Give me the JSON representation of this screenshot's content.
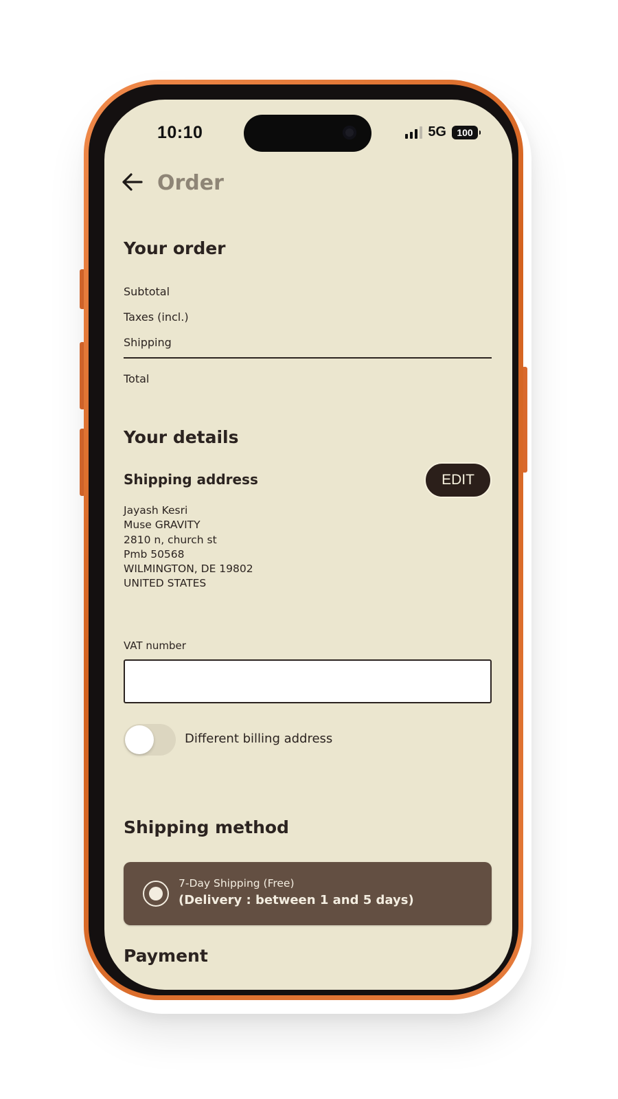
{
  "status_bar": {
    "time": "10:10",
    "network": "5G",
    "battery": "100"
  },
  "header": {
    "title": "Order",
    "back_icon": "arrow-left-icon"
  },
  "order": {
    "heading": "Your order",
    "rows": [
      "Subtotal",
      "Taxes (incl.)",
      "Shipping"
    ],
    "total_label": "Total"
  },
  "details": {
    "heading": "Your details",
    "shipping_address_label": "Shipping address",
    "edit_label": "EDIT",
    "address_lines": [
      "Jayash Kesri",
      "Muse GRAVITY",
      "2810 n, church st",
      "Pmb 50568",
      "WILMINGTON, DE 19802",
      "UNITED STATES"
    ],
    "vat_label": "VAT number",
    "vat_value": "",
    "billing_toggle_label": "Different billing address",
    "billing_toggle_on": false
  },
  "shipping_method": {
    "heading": "Shipping method",
    "option_title": "7-Day Shipping (Free)",
    "option_detail": "(Delivery : between 1 and 5 days)",
    "selected": true
  },
  "payment": {
    "heading": "Payment"
  },
  "colors": {
    "frame": "#e07434",
    "screen_bg": "#ebe6cf",
    "text_dark": "#2b2320",
    "title_muted": "#8e8576",
    "button_dark": "#2b1f1a",
    "option_bg": "#634f42"
  }
}
